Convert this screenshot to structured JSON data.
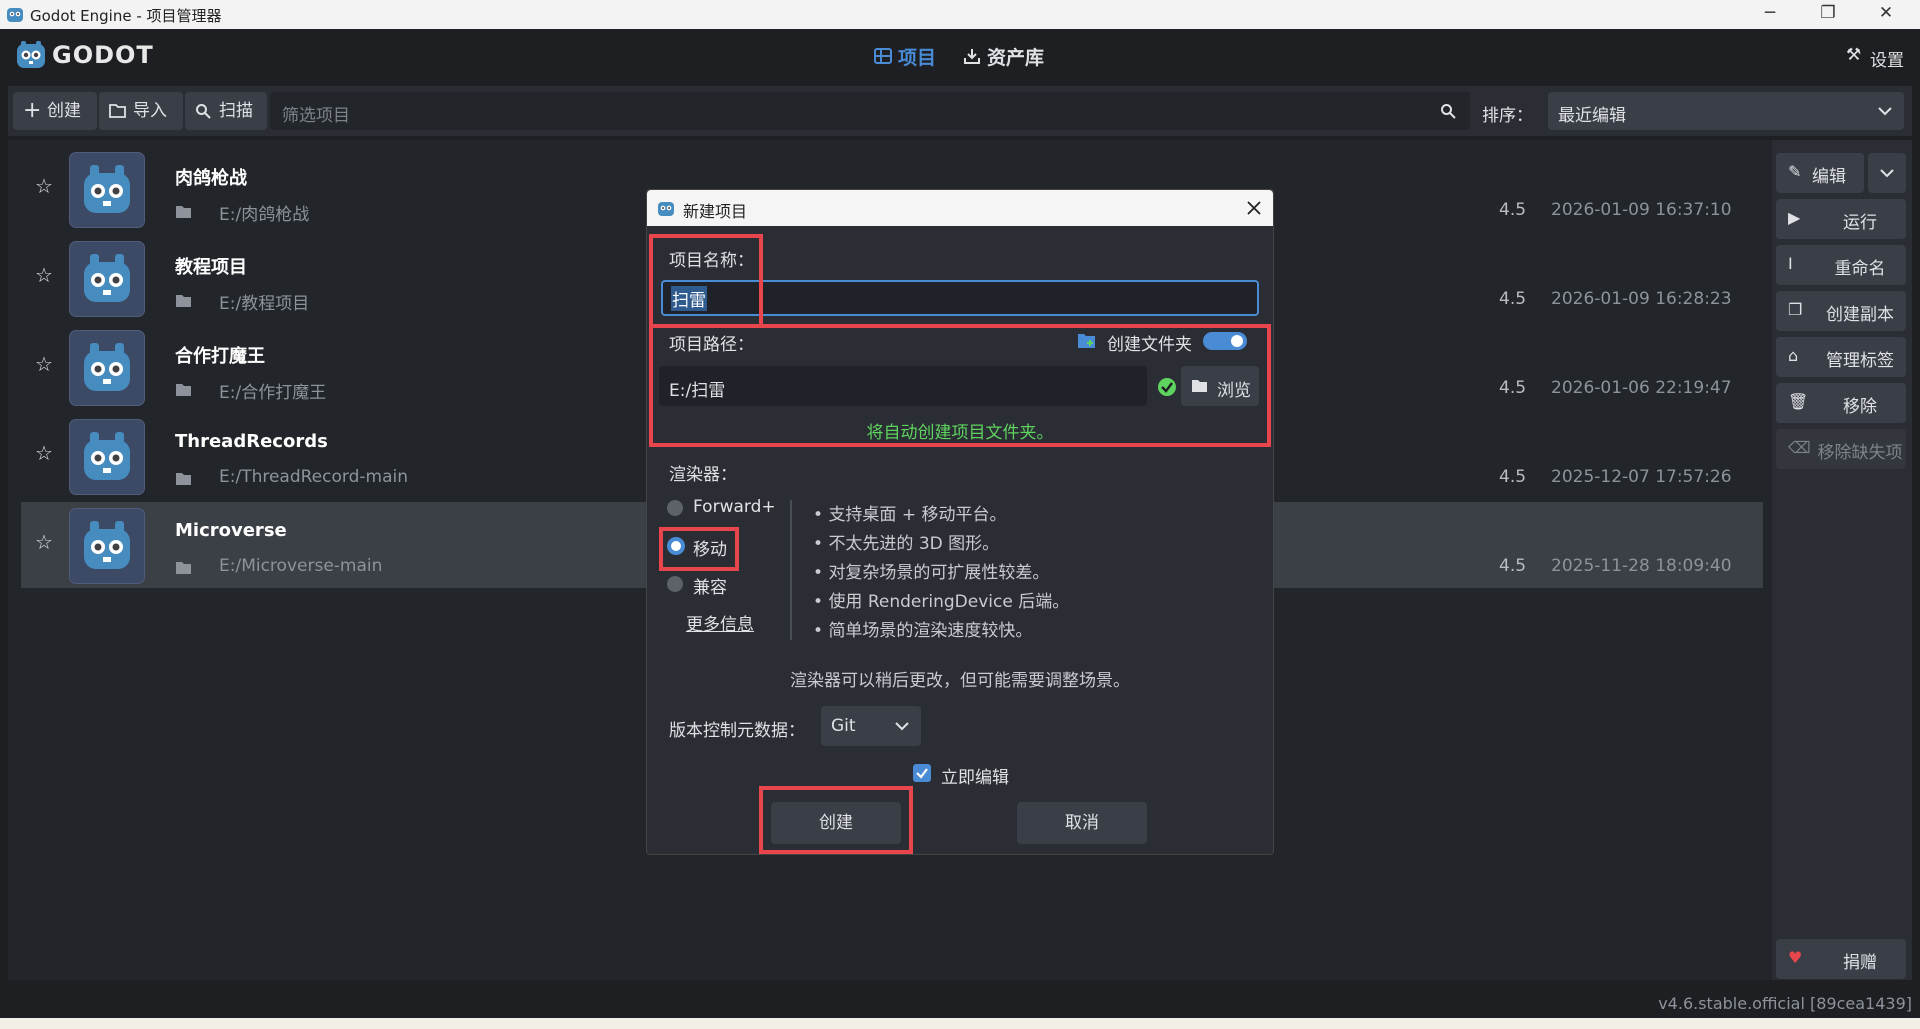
{
  "window": {
    "title": "Godot Engine - 项目管理器",
    "minimize": "─",
    "restore": "❐",
    "close": "✕"
  },
  "header": {
    "logo": "GODOT",
    "tab_projects": "项目",
    "tab_assets": "资产库",
    "settings": "设置"
  },
  "toolbar": {
    "create": "创建",
    "import": "导入",
    "scan": "扫描",
    "filter_placeholder": "筛选项目",
    "sort_label": "排序：",
    "sort_value": "最近编辑"
  },
  "projects": [
    {
      "name": "肉鸽枪战",
      "path": "E:/肉鸽枪战",
      "version": "4.5",
      "date": "2026-01-09 16:37:10"
    },
    {
      "name": "教程项目",
      "path": "E:/教程项目",
      "version": "4.5",
      "date": "2026-01-09 16:28:23"
    },
    {
      "name": "合作打魔王",
      "path": "E:/合作打魔王",
      "version": "4.5",
      "date": "2026-01-06 22:19:47"
    },
    {
      "name": "ThreadRecords",
      "path": "E:/ThreadRecord-main",
      "version": "4.5",
      "date": "2025-12-07 17:57:26"
    },
    {
      "name": "Microverse",
      "path": "E:/Microverse-main",
      "version": "4.5",
      "date": "2025-11-28 18:09:40"
    }
  ],
  "side_actions": {
    "edit": "编辑",
    "run": "运行",
    "rename": "重命名",
    "duplicate": "创建副本",
    "manage_tags": "管理标签",
    "remove": "移除",
    "remove_missing": "移除缺失项",
    "donate": "捐赠"
  },
  "version_info": "v4.6.stable.official [89cea1439]",
  "dialog": {
    "title": "新建项目",
    "name_label": "项目名称：",
    "name_value": "扫雷",
    "path_label": "项目路径：",
    "create_folder_label": "创建文件夹",
    "create_folder_on": true,
    "path_value": "E:/扫雷",
    "browse": "浏览",
    "path_status": "将自动创建项目文件夹。",
    "renderer_label": "渲染器：",
    "renderers": [
      "Forward+",
      "移动",
      "兼容"
    ],
    "renderer_selected": "移动",
    "more_info": "更多信息",
    "renderer_features": [
      "支持桌面 + 移动平台。",
      "不太先进的 3D 图形。",
      "对复杂场景的可扩展性较差。",
      "使用 RenderingDevice 后端。",
      "简单场景的渲染速度较快。"
    ],
    "renderer_note": "渲染器可以稍后更改，但可能需要调整场景。",
    "vcs_label": "版本控制元数据：",
    "vcs_value": "Git",
    "edit_now_label": "立即编辑",
    "edit_now_checked": true,
    "create_button": "创建",
    "cancel_button": "取消"
  },
  "colors": {
    "accent": "#4a8bd6",
    "highlight_box": "#e8464c",
    "success": "#5fd35f",
    "donate_heart": "#e8464c"
  }
}
